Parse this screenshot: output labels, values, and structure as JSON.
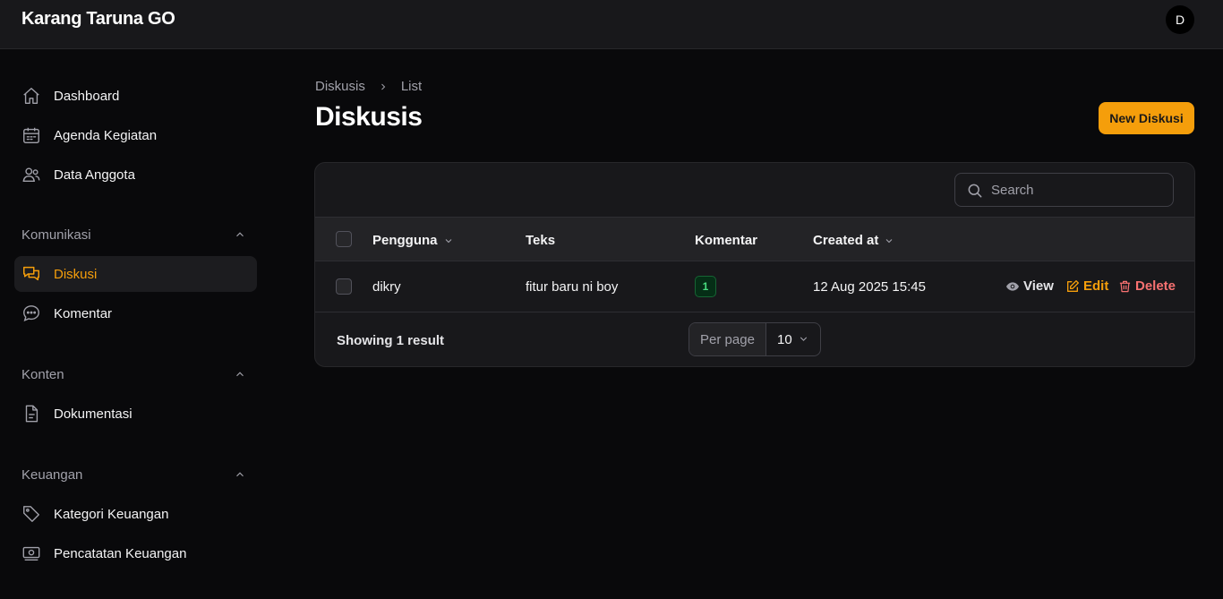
{
  "app": {
    "title": "Karang Taruna GO",
    "avatar_initial": "D"
  },
  "sidebar": {
    "main_items": [
      {
        "label": "Dashboard",
        "icon": "home-icon"
      },
      {
        "label": "Agenda Kegiatan",
        "icon": "calendar-icon"
      },
      {
        "label": "Data Anggota",
        "icon": "users-icon"
      }
    ],
    "groups": [
      {
        "label": "Komunikasi",
        "items": [
          {
            "label": "Diskusi",
            "icon": "chat-bubbles-icon",
            "active": true
          },
          {
            "label": "Komentar",
            "icon": "comment-dots-icon"
          }
        ]
      },
      {
        "label": "Konten",
        "items": [
          {
            "label": "Dokumentasi",
            "icon": "document-icon"
          }
        ]
      },
      {
        "label": "Keuangan",
        "items": [
          {
            "label": "Kategori Keuangan",
            "icon": "tag-icon"
          },
          {
            "label": "Pencatatan Keuangan",
            "icon": "banknote-icon"
          }
        ]
      }
    ]
  },
  "breadcrumb": {
    "parent": "Diskusis",
    "current": "List"
  },
  "page": {
    "title": "Diskusis",
    "new_button": "New Diskusi"
  },
  "table": {
    "search_placeholder": "Search",
    "columns": [
      "Pengguna",
      "Teks",
      "Komentar",
      "Created at"
    ],
    "rows": [
      {
        "pengguna": "dikry",
        "teks": "fitur baru ni boy",
        "komentar": "1",
        "created_at": "12 Aug 2025 15:45"
      }
    ],
    "actions": {
      "view": "View",
      "edit": "Edit",
      "delete": "Delete"
    },
    "footer": {
      "showing": "Showing 1 result",
      "per_page_label": "Per page",
      "per_page_value": "10"
    }
  },
  "colors": {
    "accent": "#f59e0b",
    "danger": "#f87171",
    "success": "#4ade80",
    "background": "#09090b",
    "surface": "#18181b"
  }
}
